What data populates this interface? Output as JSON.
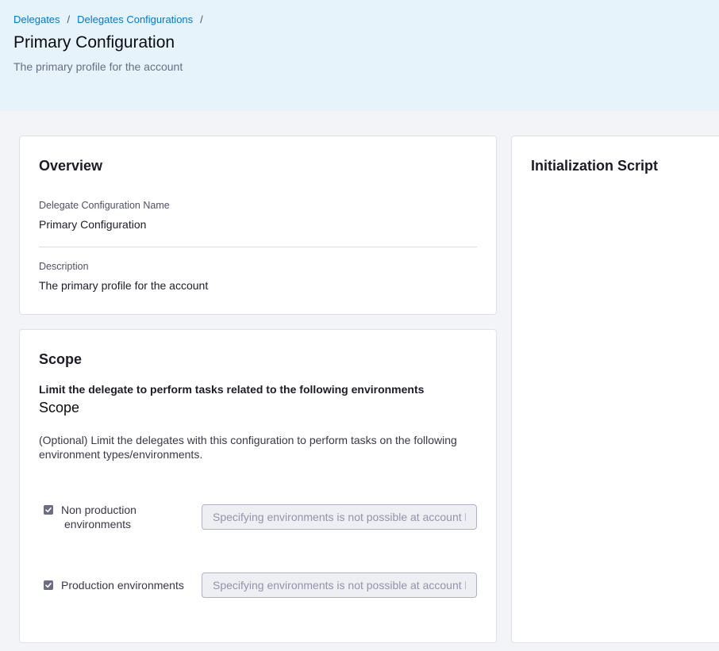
{
  "breadcrumb": {
    "items": [
      "Delegates",
      "Delegates Configurations"
    ],
    "separator": "/"
  },
  "header": {
    "title": "Primary Configuration",
    "subtitle": "The primary profile for the account"
  },
  "overview": {
    "title": "Overview",
    "name_label": "Delegate Configuration Name",
    "name_value": "Primary Configuration",
    "description_label": "Description",
    "description_value": "The primary profile for the account"
  },
  "scope": {
    "title": "Scope",
    "heading": "Limit the delegate to perform tasks related to the following environments",
    "subheading": "Scope",
    "description": "(Optional) Limit the delegates with this configuration to perform tasks on the following environment types/environments.",
    "environments": [
      {
        "label_line1": "Non production",
        "label_line2": "environments",
        "checked": true,
        "placeholder": "Specifying environments is not possible at account level"
      },
      {
        "label_line1": "Production environments",
        "label_line2": "",
        "checked": true,
        "placeholder": "Specifying environments is not possible at account level"
      }
    ]
  },
  "script": {
    "title": "Initialization Script"
  },
  "colors": {
    "header_bg": "#e6f3fb",
    "link": "#0278d5",
    "checkbox": "#6b6d85"
  },
  "icons": {
    "checkbox": "checkmark-icon"
  }
}
